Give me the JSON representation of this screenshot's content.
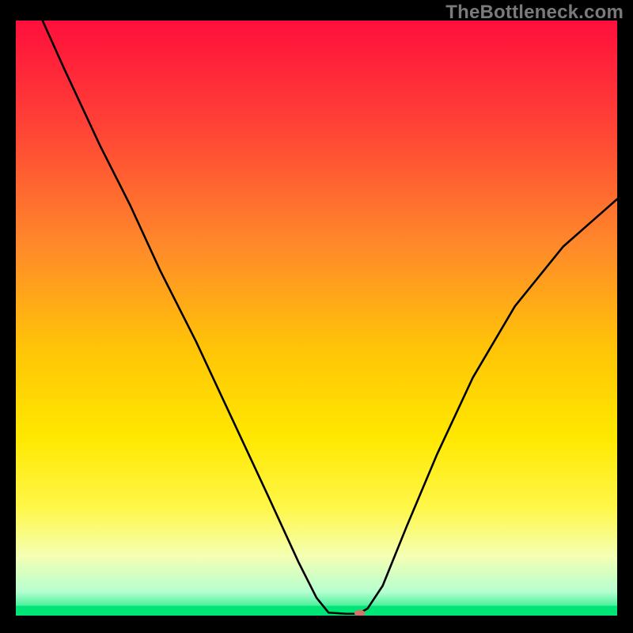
{
  "watermark": "TheBottleneck.com",
  "chart_data": {
    "type": "line",
    "title": "",
    "xlabel": "",
    "ylabel": "",
    "xlim": [
      0,
      100
    ],
    "ylim": [
      0,
      100
    ],
    "legend": false,
    "grid": false,
    "background_gradient": {
      "stops": [
        {
          "offset": 0.0,
          "color": "#ff0f3c"
        },
        {
          "offset": 0.18,
          "color": "#ff4336"
        },
        {
          "offset": 0.38,
          "color": "#ff8a2a"
        },
        {
          "offset": 0.55,
          "color": "#ffc407"
        },
        {
          "offset": 0.7,
          "color": "#ffe800"
        },
        {
          "offset": 0.82,
          "color": "#fff74a"
        },
        {
          "offset": 0.9,
          "color": "#f4ffb3"
        },
        {
          "offset": 0.96,
          "color": "#b6ffd0"
        },
        {
          "offset": 1.0,
          "color": "#00e676"
        }
      ]
    },
    "series": [
      {
        "name": "curve",
        "points": [
          {
            "x": 4.0,
            "y": 101
          },
          {
            "x": 8.0,
            "y": 92
          },
          {
            "x": 14.0,
            "y": 79
          },
          {
            "x": 19.0,
            "y": 69
          },
          {
            "x": 24.0,
            "y": 58
          },
          {
            "x": 30.0,
            "y": 46
          },
          {
            "x": 36.0,
            "y": 33
          },
          {
            "x": 42.0,
            "y": 20
          },
          {
            "x": 47.0,
            "y": 9
          },
          {
            "x": 50.0,
            "y": 3
          },
          {
            "x": 52.0,
            "y": 0.5
          },
          {
            "x": 55.0,
            "y": 0.3
          },
          {
            "x": 57.0,
            "y": 0.3
          },
          {
            "x": 58.5,
            "y": 1.2
          },
          {
            "x": 61.0,
            "y": 5
          },
          {
            "x": 65.0,
            "y": 15
          },
          {
            "x": 70.0,
            "y": 27
          },
          {
            "x": 76.0,
            "y": 40
          },
          {
            "x": 83.0,
            "y": 52
          },
          {
            "x": 91.0,
            "y": 62
          },
          {
            "x": 100.0,
            "y": 70
          }
        ]
      }
    ],
    "marker": {
      "x": 57.2,
      "y": 0.4,
      "rx": 0.9,
      "ry": 0.55,
      "color": "#d4746c"
    }
  }
}
